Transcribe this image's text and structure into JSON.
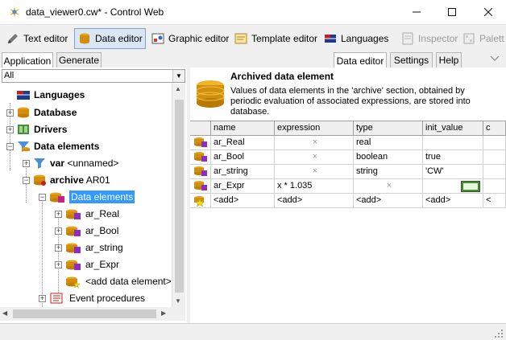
{
  "window": {
    "title": "data_viewer0.cw* - Control Web"
  },
  "toolbar": {
    "text_editor": "Text editor",
    "data_editor": "Data editor",
    "graphic_editor": "Graphic editor",
    "template_editor": "Template editor",
    "languages": "Languages",
    "inspector": "Inspector",
    "palette": "Palett"
  },
  "tabs_left": {
    "application": "Application",
    "generate": "Generate"
  },
  "tabs_right": {
    "data_editor": "Data editor",
    "settings": "Settings",
    "help": "Help"
  },
  "filter": {
    "value": "All"
  },
  "tree": {
    "languages": "Languages",
    "database": "Database",
    "drivers": "Drivers",
    "data_elements": "Data elements",
    "var_name": "var",
    "var_sub": "<unnamed>",
    "archive_name": "archive",
    "archive_sub": "AR01",
    "archive_data_elements": "Data elements",
    "items": [
      "ar_Real",
      "ar_Bool",
      "ar_string",
      "ar_Expr"
    ],
    "add_data_element": "<add data element>",
    "event_procedures": "Event procedures"
  },
  "panel": {
    "title": "Archived data element",
    "description": "Values of data elements in the 'archive' section, obtained by periodic evaluation of associated expressions, are stored into database."
  },
  "grid": {
    "columns": [
      "name",
      "expression",
      "type",
      "init_value",
      "c"
    ],
    "rows": [
      {
        "name": "ar_Real",
        "expression": "×",
        "type": "real",
        "init_value": ""
      },
      {
        "name": "ar_Bool",
        "expression": "×",
        "type": "boolean",
        "init_value": "true"
      },
      {
        "name": "ar_string",
        "expression": "×",
        "type": "string",
        "init_value": "'CW'"
      },
      {
        "name": "ar_Expr",
        "expression": "x * 1.035",
        "type": "×",
        "init_value": ""
      }
    ],
    "add_row": {
      "name": "<add>",
      "expression": "<add>",
      "type": "<add>",
      "init_value": "<add>",
      "c": "<"
    }
  }
}
